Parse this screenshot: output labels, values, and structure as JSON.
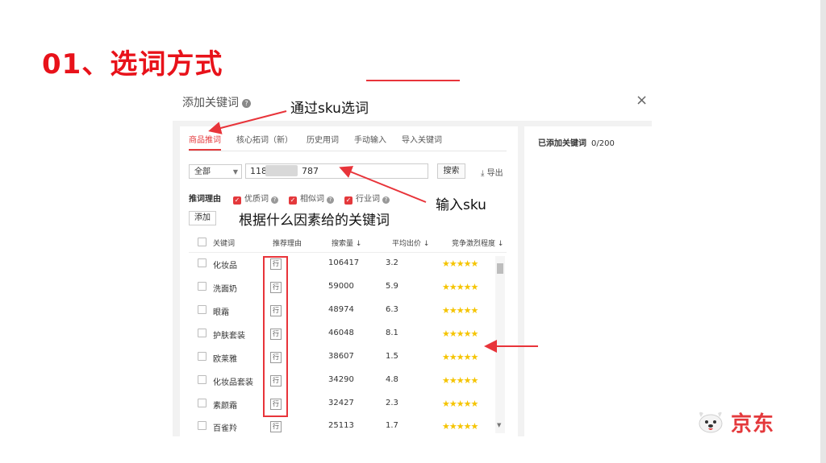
{
  "slide": {
    "title": "01、选词方式"
  },
  "dialog": {
    "title": "添加关键词",
    "close": "×",
    "tabs": [
      "商品推词",
      "核心拓词（新）",
      "历史用词",
      "手动输入",
      "导入关键词"
    ],
    "active_tab": 0,
    "select_value": "全部",
    "sku_prefix": "118",
    "sku_suffix": "787",
    "search_label": "搜索",
    "export_label": "导出",
    "reason_label": "推词理由",
    "checkboxes": [
      "优质词",
      "相似词",
      "行业词"
    ],
    "add_label": "添加",
    "added_label": "已添加关键词",
    "added_count": "0/200",
    "columns": [
      "关键词",
      "推荐理由",
      "搜索量 ↓",
      "平均出价 ↓",
      "竞争激烈程度 ↓"
    ],
    "rows": [
      {
        "keyword": "化妆品",
        "tag": "行",
        "volume": "106417",
        "price": "3.2",
        "stars": "★★★★★"
      },
      {
        "keyword": "洗面奶",
        "tag": "行",
        "volume": "59000",
        "price": "5.9",
        "stars": "★★★★★"
      },
      {
        "keyword": "眼霜",
        "tag": "行",
        "volume": "48974",
        "price": "6.3",
        "stars": "★★★★★"
      },
      {
        "keyword": "护肤套装",
        "tag": "行",
        "volume": "46048",
        "price": "8.1",
        "stars": "★★★★★"
      },
      {
        "keyword": "欧莱雅",
        "tag": "行",
        "volume": "38607",
        "price": "1.5",
        "stars": "★★★★★"
      },
      {
        "keyword": "化妆品套装",
        "tag": "行",
        "volume": "34290",
        "price": "4.8",
        "stars": "★★★★★"
      },
      {
        "keyword": "素颜霜",
        "tag": "行",
        "volume": "32427",
        "price": "2.3",
        "stars": "★★★★★"
      },
      {
        "keyword": "百雀羚",
        "tag": "行",
        "volume": "25113",
        "price": "1.7",
        "stars": "★★★★★"
      }
    ]
  },
  "annotations": {
    "sku_select": "通过sku选词",
    "input_sku": "输入sku",
    "reason": "根据什么因素给的关键词"
  },
  "logo": {
    "text": "京东"
  },
  "colors": {
    "title_red": "#e8121a",
    "accent_red": "#e4393c",
    "star_yellow": "#f5c400"
  }
}
